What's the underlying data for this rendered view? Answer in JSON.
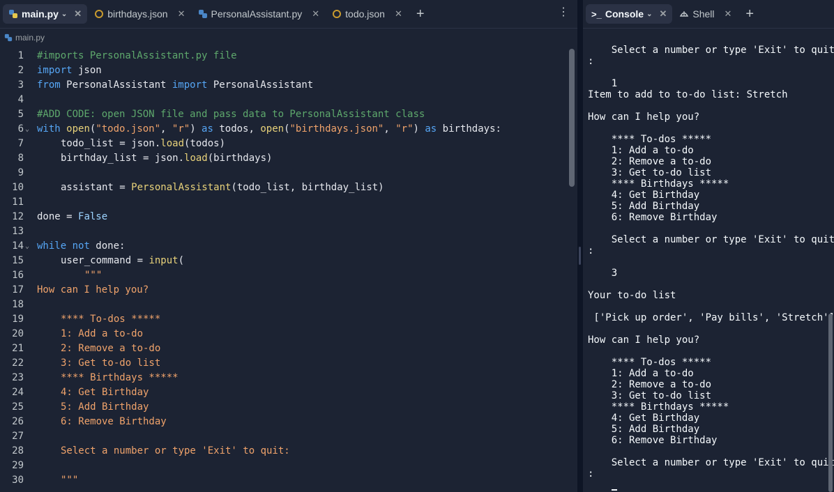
{
  "editor": {
    "tabs": [
      {
        "label": "main.py",
        "icon": "python-icon",
        "active": true
      },
      {
        "label": "birthdays.json",
        "icon": "json-icon",
        "active": false
      },
      {
        "label": "PersonalAssistant.py",
        "icon": "python-icon",
        "active": false
      },
      {
        "label": "todo.json",
        "icon": "json-icon",
        "active": false
      }
    ],
    "breadcrumb": "main.py",
    "line_numbers": [
      "1",
      "2",
      "3",
      "4",
      "5",
      "6",
      "7",
      "8",
      "9",
      "10",
      "11",
      "12",
      "13",
      "14",
      "15",
      "16",
      "17",
      "18",
      "19",
      "20",
      "21",
      "22",
      "23",
      "24",
      "25",
      "26",
      "27",
      "28",
      "29",
      "30"
    ],
    "code": {
      "l1": "#imports PersonalAssistant.py file",
      "l2_kw": "import",
      "l2_mod": " json",
      "l3_kw1": "from",
      "l3_mod": " PersonalAssistant ",
      "l3_kw2": "import",
      "l3_cls": " PersonalAssistant",
      "l5": "#ADD CODE: open JSON file and pass data to PersonalAssistant class",
      "l6_kw": "with",
      "l6_fn1": "open",
      "l6_p1": "(",
      "l6_s1": "\"todo.json\"",
      "l6_c1": ", ",
      "l6_s2": "\"r\"",
      "l6_p2": ") ",
      "l6_as1": "as",
      "l6_v1": " todos, ",
      "l6_fn2": "open",
      "l6_p3": "(",
      "l6_s3": "\"birthdays.json\"",
      "l6_c2": ", ",
      "l6_s4": "\"r\"",
      "l6_p4": ") ",
      "l6_as2": "as",
      "l6_v2": " birthdays:",
      "l7_a": "todo_list = json.",
      "l7_fn": "load",
      "l7_b": "(todos)",
      "l8_a": "birthday_list = json.",
      "l8_fn": "load",
      "l8_b": "(birthdays)",
      "l10_a": "assistant = ",
      "l10_fn": "PersonalAssistant",
      "l10_b": "(todo_list, birthday_list)",
      "l12_a": "done = ",
      "l12_kw": "False",
      "l14_kw1": "while",
      "l14_kw2": " not",
      "l14_b": " done:",
      "l15_a": "user_command = ",
      "l15_fn": "input",
      "l15_b": "(",
      "l16": "\"\"\"",
      "l17": "How can I help you?",
      "l19": "**** To-dos *****",
      "l20": "1: Add a to-do",
      "l21": "2: Remove a to-do",
      "l22": "3: Get to-do list",
      "l23": "**** Birthdays *****",
      "l24": "4: Get Birthday",
      "l25": "5: Add Birthday",
      "l26": "6: Remove Birthday",
      "l28": "Select a number or type 'Exit' to quit:",
      "l30": "\"\"\""
    }
  },
  "console": {
    "tabs": [
      {
        "label": "Console",
        "icon": "terminal-icon",
        "active": true
      },
      {
        "label": "Shell",
        "icon": "shell-icon",
        "active": false
      }
    ],
    "lines": [
      "",
      "    Select a number or type 'Exit' to quit",
      ":",
      "",
      "    1",
      "Item to add to to-do list: Stretch",
      "",
      "How can I help you?",
      "",
      "    **** To-dos *****",
      "    1: Add a to-do",
      "    2: Remove a to-do",
      "    3: Get to-do list",
      "    **** Birthdays *****",
      "    4: Get Birthday",
      "    5: Add Birthday",
      "    6: Remove Birthday",
      "",
      "    Select a number or type 'Exit' to quit",
      ":",
      "",
      "    3",
      "",
      "Your to-do list",
      "",
      " ['Pick up order', 'Pay bills', 'Stretch']",
      "",
      "How can I help you?",
      "",
      "    **** To-dos *****",
      "    1: Add a to-do",
      "    2: Remove a to-do",
      "    3: Get to-do list",
      "    **** Birthdays *****",
      "    4: Get Birthday",
      "    5: Add Birthday",
      "    6: Remove Birthday",
      "",
      "    Select a number or type 'Exit' to quit",
      ":"
    ]
  },
  "colors": {
    "background": "#1c2333",
    "keyword": "#56a6f5",
    "function": "#e8d27a",
    "string": "#f0a36b",
    "comment": "#5ea86c"
  }
}
